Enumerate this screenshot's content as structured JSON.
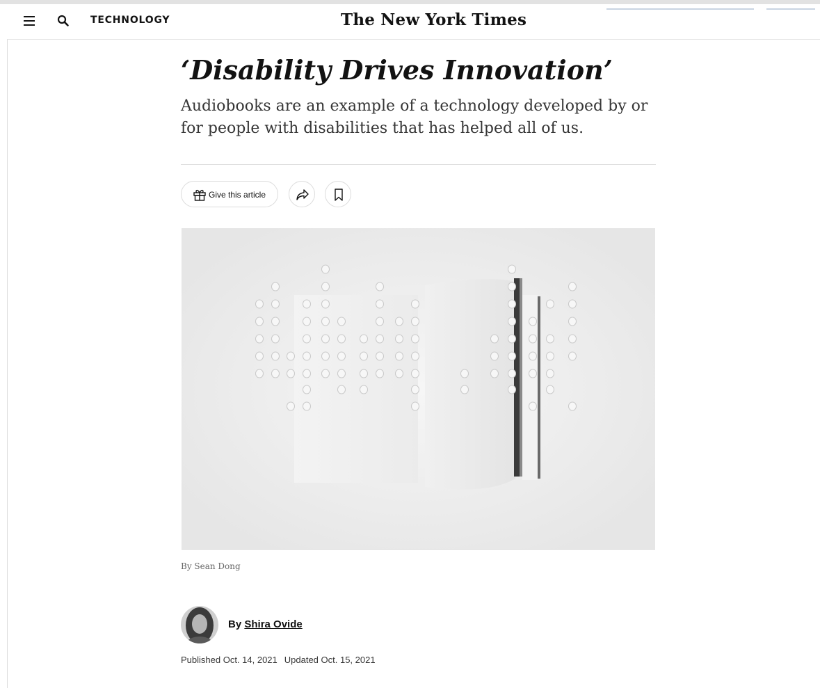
{
  "header": {
    "section_label": "TECHNOLOGY",
    "logo_text": "The New York Times"
  },
  "article": {
    "headline": "‘Disability Drives Innovation’",
    "summary": "Audiobooks are an example of a technology developed by or for people with disabilities that has helped all of us.",
    "gift_button_label": "Give this article",
    "image_credit": "By Sean Dong",
    "byline_prefix": "By",
    "author": "Shira Ovide",
    "published": "Published Oct. 14, 2021",
    "updated": "Updated Oct. 15, 2021"
  },
  "icons": [
    "menu-icon",
    "search-icon",
    "gift-icon",
    "share-icon",
    "bookmark-icon"
  ]
}
